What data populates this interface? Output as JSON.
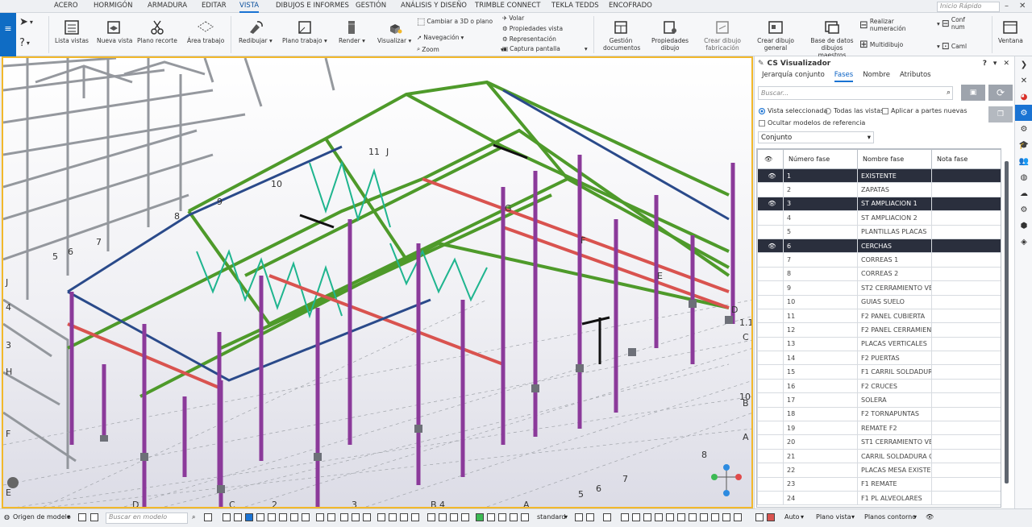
{
  "tabs": [
    "ACERO",
    "HORMIGÓN",
    "ARMADURA",
    "EDITAR",
    "VISTA",
    "DIBUJOS E INFORMES",
    "GESTIÓN",
    "ANÁLISIS Y DISEÑO",
    "TRIMBLE CONNECT",
    "TEKLA TEDDS",
    "ENCOFRADO"
  ],
  "active_tab": "VISTA",
  "quick_search_placeholder": "Inicio Rápido",
  "ribbon": {
    "lista_vistas": "Lista vistas",
    "nueva_vista": "Nueva vista",
    "plano_recorte": "Plano recorte",
    "area_trabajo": "Área trabajo",
    "redibujar": "Redibujar",
    "plano_trabajo": "Plano trabajo",
    "render": "Render",
    "visualizar": "Visualizar",
    "cambiar_3d": "Cambiar a 3D o plano",
    "navegacion": "Navegación",
    "zoom": "Zoom",
    "volar": "Volar",
    "propiedades_vista": "Propiedades vista",
    "representacion": "Representación",
    "captura": "Captura pantalla",
    "gestion_documentos": "Gestión documentos",
    "propiedades_dibujo": "Propiedades dibujo",
    "crear_dibujo_fabricacion": "Crear dibujo fabricación",
    "crear_dibujo_general": "Crear dibujo general",
    "base_datos": "Base de datos dibujos maestros",
    "realizar_numeracion": "Realizar numeración",
    "multidibujo": "Multidibujo",
    "conf_num": "Conf num",
    "caml": "Caml",
    "ventana": "Ventana"
  },
  "panel": {
    "title": "CS Visualizador",
    "tabs": [
      "Jerarquía conjunto",
      "Fases",
      "Nombre",
      "Atributos"
    ],
    "active_tab": "Fases",
    "search_placeholder": "Buscar...",
    "opt_vista": "Vista seleccionada",
    "opt_todas": "Todas las vistas",
    "opt_aplicar": "Aplicar a partes nuevas",
    "opt_ocultar": "Ocultar modelos de referencia",
    "select_value": "Conjunto",
    "columns": [
      "Número fase",
      "Nombre fase",
      "Nota fase"
    ],
    "rows": [
      {
        "num": "1",
        "name": "EXISTENTE",
        "visible": true
      },
      {
        "num": "2",
        "name": "ZAPATAS",
        "visible": false
      },
      {
        "num": "3",
        "name": "ST AMPLIACION 1",
        "visible": true
      },
      {
        "num": "4",
        "name": "ST AMPLIACION 2",
        "visible": false
      },
      {
        "num": "5",
        "name": "PLANTILLAS PLACAS",
        "visible": false
      },
      {
        "num": "6",
        "name": "CERCHAS",
        "visible": true
      },
      {
        "num": "7",
        "name": "CORREAS 1",
        "visible": false
      },
      {
        "num": "8",
        "name": "CORREAS 2",
        "visible": false
      },
      {
        "num": "9",
        "name": "ST2 CERRAMIENTO VERT",
        "visible": false
      },
      {
        "num": "10",
        "name": "GUIAS SUELO",
        "visible": false
      },
      {
        "num": "11",
        "name": "F2 PANEL CUBIERTA",
        "visible": false
      },
      {
        "num": "12",
        "name": "F2 PANEL CERRAMIENTO",
        "visible": false
      },
      {
        "num": "13",
        "name": "PLACAS VERTICALES",
        "visible": false
      },
      {
        "num": "14",
        "name": "F2 PUERTAS",
        "visible": false
      },
      {
        "num": "15",
        "name": "F1 CARRIL SOLDADURA",
        "visible": false
      },
      {
        "num": "16",
        "name": "F2 CRUCES",
        "visible": false
      },
      {
        "num": "17",
        "name": "SOLERA",
        "visible": false
      },
      {
        "num": "18",
        "name": "F2 TORNAPUNTAS",
        "visible": false
      },
      {
        "num": "19",
        "name": "REMATE F2",
        "visible": false
      },
      {
        "num": "20",
        "name": "ST1 CERRAMIENTO VERT",
        "visible": false
      },
      {
        "num": "21",
        "name": "CARRIL SOLDADURA OF",
        "visible": false
      },
      {
        "num": "22",
        "name": "PLACAS MESA EXISTENT",
        "visible": false
      },
      {
        "num": "23",
        "name": "F1 REMATE",
        "visible": false
      },
      {
        "num": "24",
        "name": "F1 PL ALVEOLARES",
        "visible": false
      }
    ]
  },
  "grid_labels": [
    "11",
    "J",
    "10",
    "9",
    "8",
    "7",
    "5",
    "6",
    "G",
    "F",
    "E",
    "D",
    "1.1",
    "C",
    "10",
    "B",
    "A",
    "8",
    "7",
    "6",
    "5",
    "A",
    "B 4",
    "3",
    "2",
    "C",
    "D",
    "J",
    "H",
    "4",
    "3",
    "F",
    "E"
  ],
  "status": {
    "origen": "Origen de modelo",
    "buscar_placeholder": "Buscar en modelo",
    "standard": "standard",
    "auto": "Auto",
    "plano_vista": "Plano vista",
    "planos_contorno": "Planos contorno"
  },
  "colors": {
    "accent": "#1a73d3",
    "viewport_border": "#f2b82b",
    "truss_green": "#4e9a2a",
    "column_purple": "#8b3a9a",
    "beam_blue": "#2a4a8a",
    "brace_teal": "#1fb58f",
    "existing_gray": "#8a8e94",
    "rail_red": "#d9534f"
  }
}
